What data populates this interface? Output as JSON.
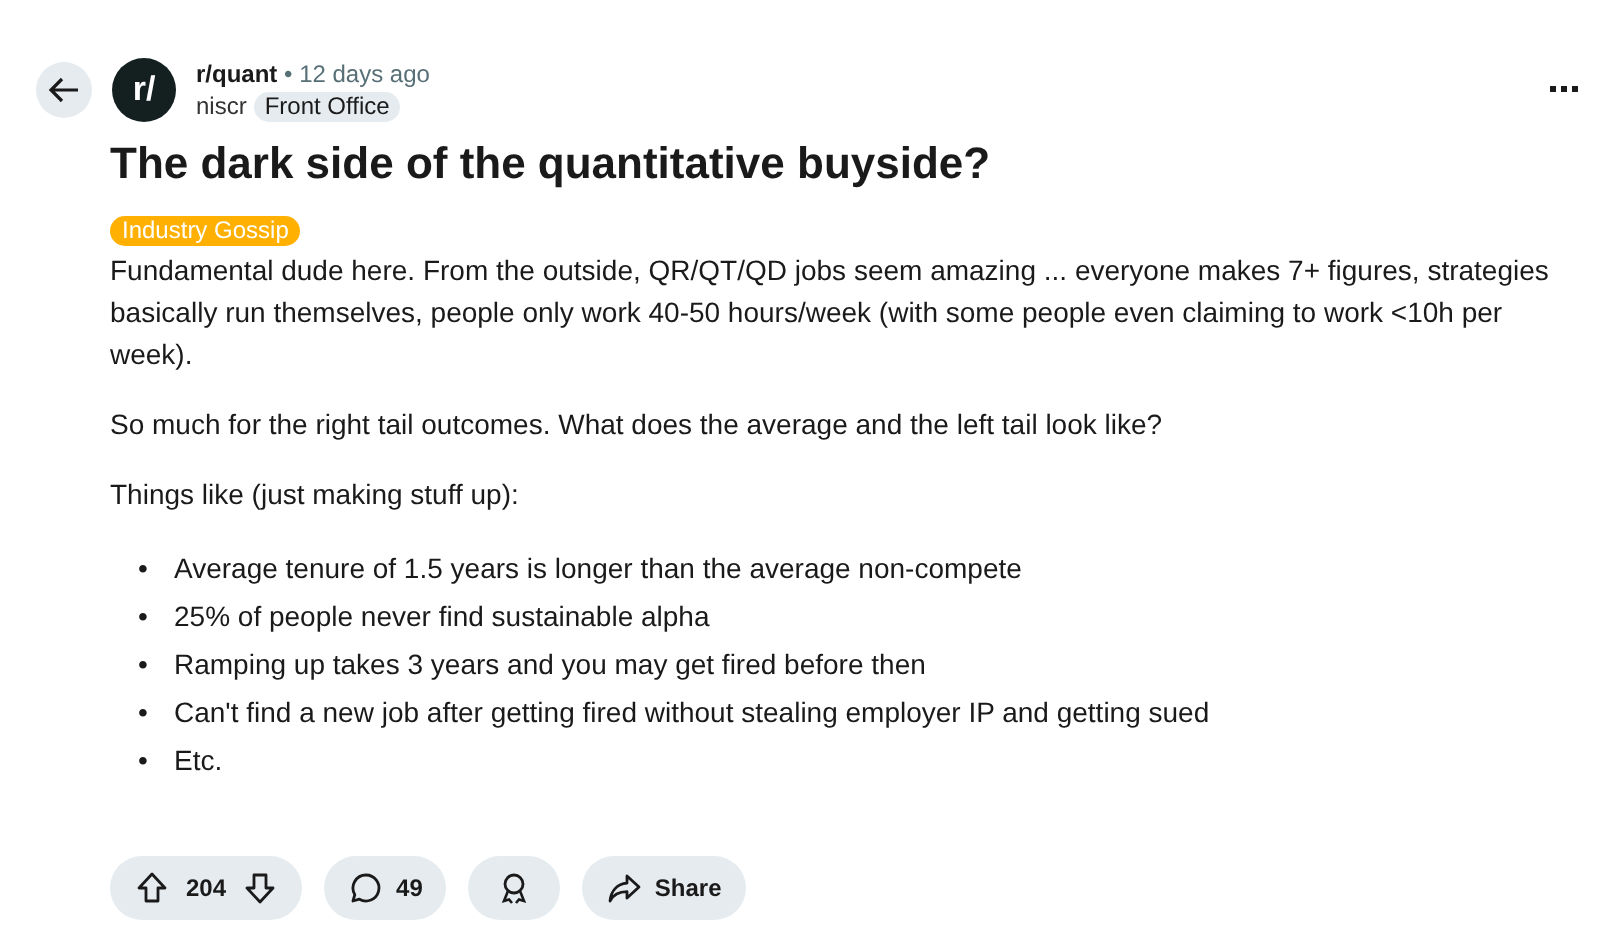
{
  "post": {
    "avatar_text": "r/",
    "subreddit": "r/quant",
    "separator": "•",
    "time": "12 days ago",
    "author": "niscr",
    "user_flair": "Front Office",
    "title": "The dark side of the quantitative buyside?",
    "post_flair": "Industry Gossip",
    "paragraphs": [
      "Fundamental dude here. From the outside, QR/QT/QD jobs seem amazing ... everyone makes 7+ figures, strategies basically run themselves, people only work 40-50 hours/week (with some people even claiming to work <10h per week).",
      "So much for the right tail outcomes. What does the average and the left tail look like?",
      "Things like (just making stuff up):"
    ],
    "bullets": [
      {
        "marker": "•",
        "text": "Average tenure of 1.5 years is longer than the average non-compete"
      },
      {
        "marker": "•",
        "text": "25% of people never find sustainable alpha"
      },
      {
        "marker": "•",
        "text": "Ramping up takes 3 years and you may get fired before then"
      },
      {
        "marker": "•",
        "text": "Can't find a new job after getting fired without stealing employer IP and getting sued"
      },
      {
        "marker": "•",
        "text": "Etc."
      }
    ],
    "votes": "204",
    "comments": "49",
    "share": "Share"
  }
}
